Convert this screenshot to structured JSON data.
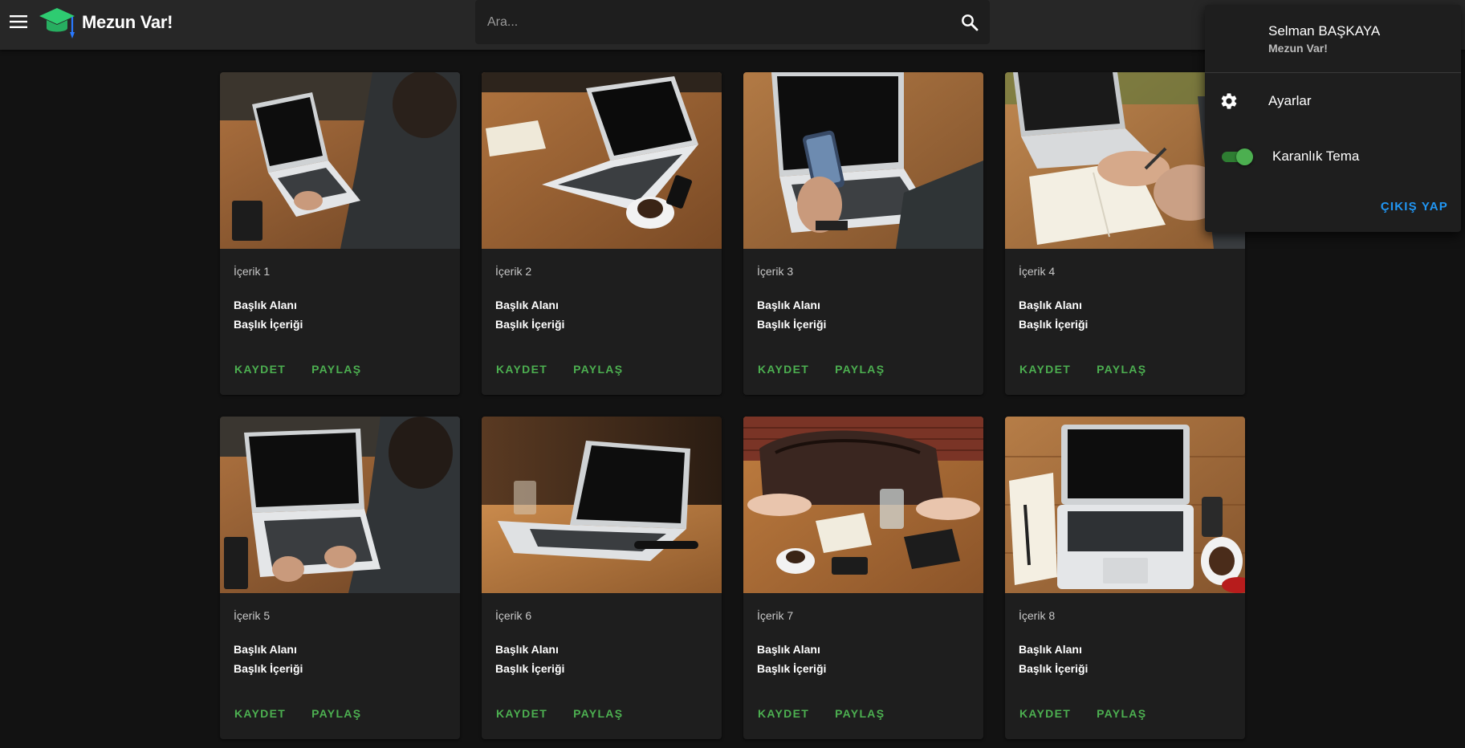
{
  "app": {
    "title": "Mezun Var!",
    "accent_color": "#4caf50",
    "logo_icon": "graduation-cap-icon"
  },
  "search": {
    "placeholder": "Ara...",
    "value": "",
    "icon": "search-icon"
  },
  "cards": [
    {
      "overline": "İçerik 1",
      "title": "Başlık Alanı",
      "body": "Başlık İçeriği",
      "save_label": "KAYDET",
      "share_label": "PAYLAŞ",
      "image": "person-typing-on-laptop"
    },
    {
      "overline": "İçerik 2",
      "title": "Başlık Alanı",
      "body": "Başlık İçeriği",
      "save_label": "KAYDET",
      "share_label": "PAYLAŞ",
      "image": "laptop-with-coffee-on-table"
    },
    {
      "overline": "İçerik 3",
      "title": "Başlık Alanı",
      "body": "Başlık İçeriği",
      "save_label": "KAYDET",
      "share_label": "PAYLAŞ",
      "image": "hand-holding-phone-at-laptop"
    },
    {
      "overline": "İçerik 4",
      "title": "Başlık Alanı",
      "body": "Başlık İçeriği",
      "save_label": "KAYDET",
      "share_label": "PAYLAŞ",
      "image": "hand-writing-in-notebook"
    },
    {
      "overline": "İçerik 5",
      "title": "Başlık Alanı",
      "body": "Başlık İçeriği",
      "save_label": "KAYDET",
      "share_label": "PAYLAŞ",
      "image": "person-typing-on-laptop"
    },
    {
      "overline": "İçerik 6",
      "title": "Başlık Alanı",
      "body": "Başlık İçeriği",
      "save_label": "KAYDET",
      "share_label": "PAYLAŞ",
      "image": "laptop-on-wooden-table"
    },
    {
      "overline": "İçerik 7",
      "title": "Başlık Alanı",
      "body": "Başlık İçeriği",
      "save_label": "KAYDET",
      "share_label": "PAYLAŞ",
      "image": "bag-glass-tablet-on-table"
    },
    {
      "overline": "İçerik 8",
      "title": "Başlık Alanı",
      "body": "Başlık İçeriği",
      "save_label": "KAYDET",
      "share_label": "PAYLAŞ",
      "image": "laptop-notebook-coffee-top-view"
    }
  ],
  "account_menu": {
    "name": "Selman BAŞKAYA",
    "subtitle": "Mezun Var!",
    "settings_label": "Ayarlar",
    "theme_label": "Karanlık Tema",
    "dark_theme_enabled": true,
    "logout_label": "ÇIKIŞ YAP",
    "logout_color": "#2196f3"
  }
}
